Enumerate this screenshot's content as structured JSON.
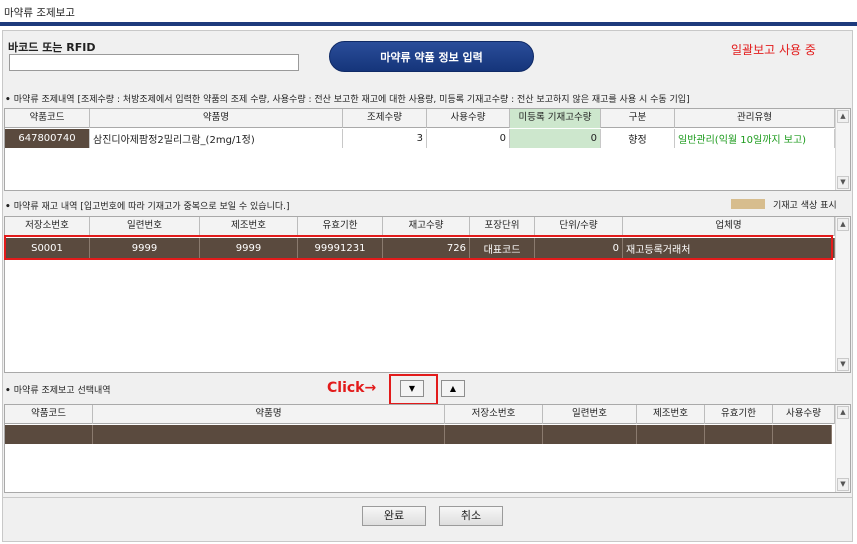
{
  "window": {
    "title": "마약류 조제보고"
  },
  "barcode": {
    "label": "바코드 또는 RFID",
    "value": ""
  },
  "drug_info_button": "마약류 약품 정보 입력",
  "bulk_status": "일괄보고 사용 중",
  "dispense_section": {
    "bullet": "•",
    "title": "마약류 조제내역 [조제수량 : 처방조제에서 입력한 약품의 조제 수량, 사용수량 : 전산 보고한 재고에 대한 사용량, 미등록 기재고수량 : 전산 보고하지 않은 재고를 사용 시 수동 기입]",
    "columns": [
      "약품코드",
      "약품명",
      "조제수량",
      "사용수량",
      "미등록 기재고수량",
      "구분",
      "관리유형"
    ],
    "rows": [
      {
        "code": "647800740",
        "name": "삼진디아제팜정2밀리그람_(2mg/1정)",
        "dispense_qty": "3",
        "use_qty": "0",
        "unreg_qty": "0",
        "category": "향정",
        "mgmt_type": "일반관리(익월 10일까지 보고)"
      }
    ]
  },
  "stock_section": {
    "bullet": "•",
    "title": "마약류 재고 내역 [입고번호에 따라 기재고가 중복으로 보일 수 있습니다.]",
    "legend_label": "기재고 색상 표시",
    "columns": [
      "저장소번호",
      "일련번호",
      "제조번호",
      "유효기한",
      "재고수량",
      "포장단위",
      "단위/수량",
      "업체명"
    ],
    "rows": [
      {
        "storage": "S0001",
        "serial": "9999",
        "lot": "9999",
        "expiry": "99991231",
        "stock_qty": "726",
        "pack_unit": "대표코드",
        "unit_qty": "0",
        "vendor": "재고등록거래처"
      }
    ]
  },
  "selection_section": {
    "bullet": "•",
    "title": "마약류 조제보고 선택내역",
    "click_label": "Click→",
    "down_button": "▼",
    "up_button": "▲",
    "columns": [
      "약품코드",
      "약품명",
      "저장소번호",
      "일련번호",
      "제조번호",
      "유효기한",
      "사용수량"
    ]
  },
  "footer": {
    "confirm_label": "완료",
    "cancel_label": "취소"
  },
  "scroll": {
    "up": "▲",
    "down": "▼"
  },
  "colors": {
    "title_bar": "#1d3a7c",
    "selected_row": "#5a4a3e",
    "unreg_header": "#cde7cd",
    "legend": "#d7bd8e",
    "highlight": "#e21b1b",
    "mgmt_text": "#1a9a1a"
  }
}
